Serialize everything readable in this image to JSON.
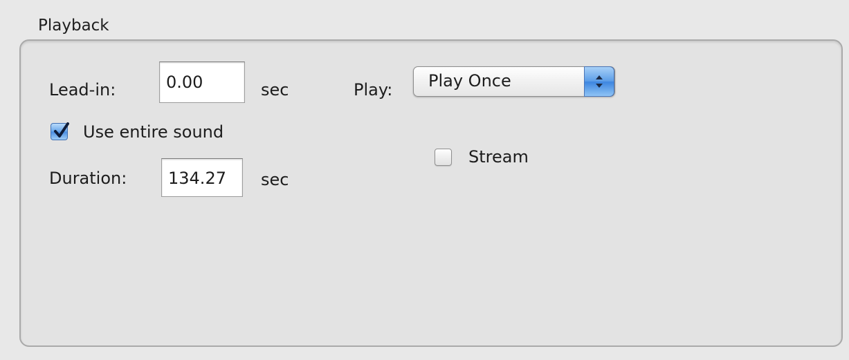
{
  "section": {
    "title": "Playback"
  },
  "lead_in": {
    "label": "Lead-in:",
    "value": "0.00",
    "unit": "sec"
  },
  "play": {
    "label": "Play:",
    "selected": "Play Once"
  },
  "use_entire_sound": {
    "label": "Use entire sound",
    "checked": true
  },
  "stream": {
    "label": "Stream",
    "checked": false
  },
  "duration": {
    "label": "Duration:",
    "value": "134.27",
    "unit": "sec"
  },
  "icons": {
    "popup_arrows": "up-down-chevron-icon",
    "checkmark": "checkmark-icon"
  },
  "colors": {
    "accent": "#5d9ee8",
    "panel_bg": "#e3e3e3"
  }
}
